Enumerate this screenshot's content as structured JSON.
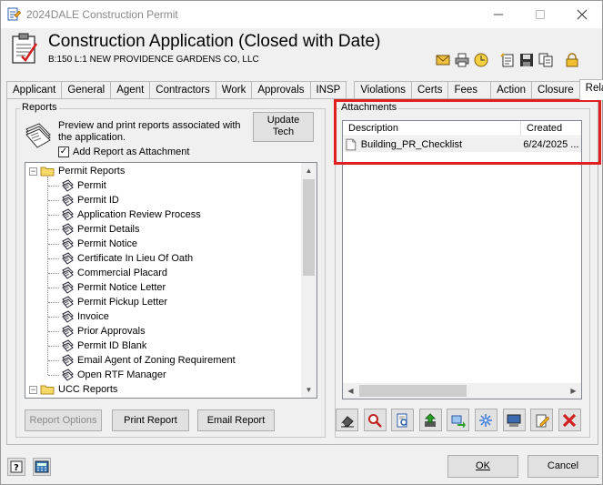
{
  "window": {
    "title": "2024DALE Construction Permit"
  },
  "header": {
    "title": "Construction Application (Closed with Date)",
    "subtitle": "B:150 L:1  NEW PROVIDENCE GARDENS CO, LLC"
  },
  "toolbar_icons": [
    "mail-icon",
    "printer-icon",
    "clock-icon",
    "notes-icon",
    "save-icon",
    "copy-icon",
    "lock-icon"
  ],
  "tabs": [
    {
      "label": "Applicant"
    },
    {
      "label": "General"
    },
    {
      "label": "Agent"
    },
    {
      "label": "Contractors"
    },
    {
      "label": "Work"
    },
    {
      "label": "Approvals"
    },
    {
      "label": "INSP"
    },
    {
      "label": "Violations"
    },
    {
      "label": "Certs"
    },
    {
      "label": "Fees"
    },
    {
      "label": "Action"
    },
    {
      "label": "Closure"
    },
    {
      "label": "Related"
    }
  ],
  "active_tab": "Related",
  "reports": {
    "group_label": "Reports",
    "description": "Preview and print reports associated with the application.",
    "update_button": "Update\nTech",
    "add_attachment_label": "Add Report as Attachment",
    "add_attachment_checked": true,
    "tree": {
      "folders": [
        {
          "label": "Permit Reports",
          "expanded": true,
          "items": [
            "Permit",
            "Permit ID",
            "Application Review Process",
            "Permit Details",
            "Permit Notice",
            "Certificate In Lieu Of Oath",
            "Commercial Placard",
            "Permit Notice Letter",
            "Permit Pickup Letter",
            "Invoice",
            "Prior Approvals",
            "Permit ID Blank",
            "Email Agent of Zoning Requirement",
            "Open RTF Manager"
          ]
        },
        {
          "label": "UCC Reports",
          "expanded": true,
          "items": []
        }
      ]
    },
    "buttons": {
      "report_options": "Report Options",
      "print_report": "Print Report",
      "email_report": "Email Report"
    }
  },
  "attachments": {
    "group_label": "Attachments",
    "columns": [
      "Description",
      "Created"
    ],
    "rows": [
      {
        "description": "Building_PR_Checklist",
        "created": "6/24/2025 ..."
      }
    ],
    "tool_icons": [
      "eraser-icon",
      "magnifier-icon",
      "document-view-icon",
      "upload-icon",
      "transfer-icon",
      "scan-icon",
      "monitor-icon",
      "edit-icon",
      "delete-icon"
    ]
  },
  "footer": {
    "ok": "OK",
    "cancel": "Cancel"
  },
  "colors": {
    "highlight": "#e02020",
    "delete": "#d42020"
  }
}
